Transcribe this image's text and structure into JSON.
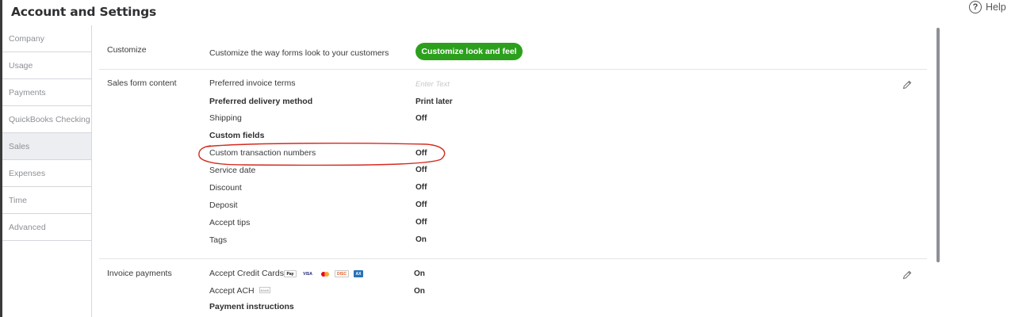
{
  "header": {
    "title": "Account and Settings",
    "help_label": "Help"
  },
  "sidebar": {
    "items": [
      {
        "label": "Company"
      },
      {
        "label": "Usage"
      },
      {
        "label": "Payments"
      },
      {
        "label": "QuickBooks Checking"
      },
      {
        "label": "Sales",
        "active": true
      },
      {
        "label": "Expenses"
      },
      {
        "label": "Time"
      },
      {
        "label": "Advanced"
      }
    ]
  },
  "customize": {
    "label": "Customize",
    "description": "Customize the way forms look to your customers",
    "button_label": "Customize look and feel"
  },
  "sales_form_content": {
    "label": "Sales form content",
    "preferred_invoice_terms": {
      "label": "Preferred invoice terms",
      "placeholder": "Enter Text"
    },
    "preferred_delivery_method": {
      "label": "Preferred delivery method",
      "value": "Print later"
    },
    "shipping": {
      "label": "Shipping",
      "value": "Off"
    },
    "custom_fields_label": "Custom fields",
    "custom_transaction_numbers": {
      "label": "Custom transaction numbers",
      "value": "Off"
    },
    "service_date": {
      "label": "Service date",
      "value": "Off"
    },
    "discount": {
      "label": "Discount",
      "value": "Off"
    },
    "deposit": {
      "label": "Deposit",
      "value": "Off"
    },
    "accept_tips": {
      "label": "Accept tips",
      "value": "Off"
    },
    "tags": {
      "label": "Tags",
      "value": "On"
    }
  },
  "invoice_payments": {
    "label": "Invoice payments",
    "accept_credit_cards": {
      "label": "Accept Credit Cards",
      "value": "On",
      "card_icons": [
        "apple-pay-icon",
        "visa-icon",
        "mastercard-icon",
        "discover-icon",
        "amex-icon"
      ],
      "card_texts": {
        "applepay": "Pay",
        "visa": "VISA",
        "discover": "DISC",
        "amex": "AX"
      }
    },
    "accept_ach": {
      "label": "Accept ACH",
      "value": "On",
      "badge": "BANK"
    },
    "payment_instructions_label": "Payment instructions"
  },
  "colors": {
    "accent_green": "#2ca01c",
    "annotation_red": "#d52b1e",
    "active_sidebar_bg": "#eceef1"
  }
}
